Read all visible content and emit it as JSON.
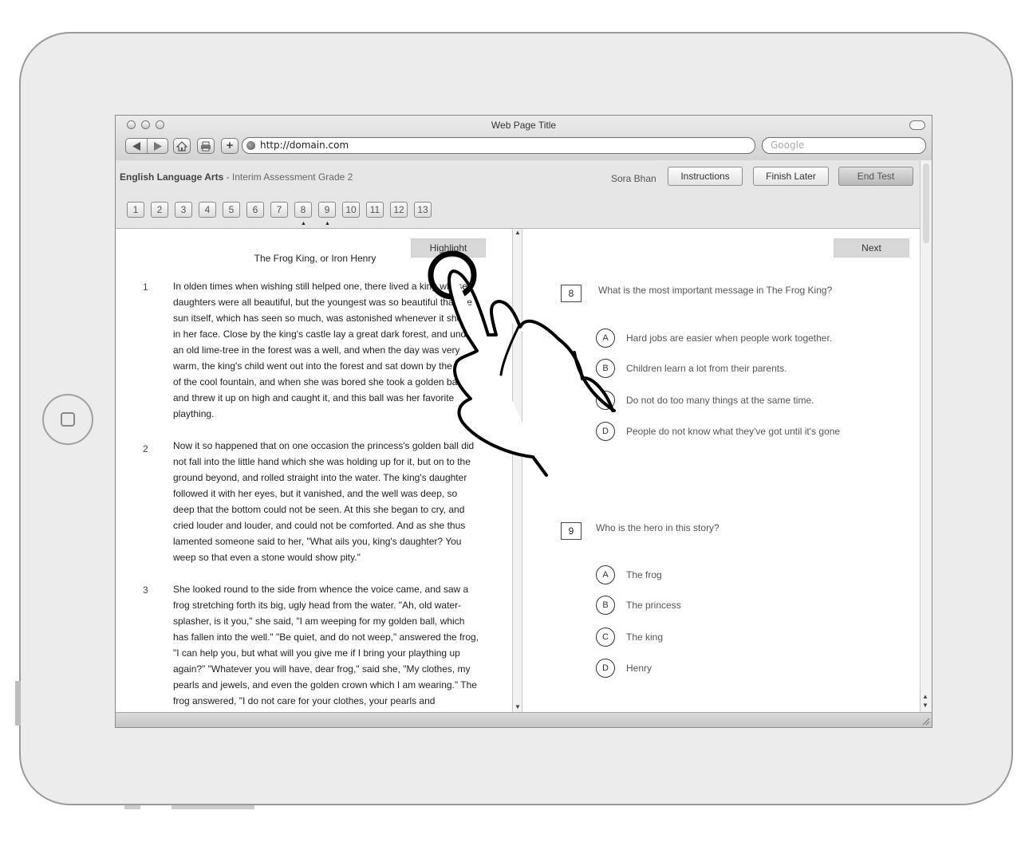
{
  "window": {
    "title": "Web Page Title"
  },
  "browser": {
    "url": "http://domain.com",
    "search_placeholder": "Google",
    "back_icon": "left-triangle",
    "forward_icon": "right-triangle",
    "home_icon": "home",
    "print_icon": "print",
    "add_icon": "+"
  },
  "app": {
    "subject": "English Language Arts",
    "assessment": " - Interim Assessment Grade 2",
    "user": "Sora Bhan",
    "instructions_label": "Instructions",
    "finish_later_label": "Finish Later",
    "end_test_label": "End Test"
  },
  "question_numbers": [
    "1",
    "2",
    "3",
    "4",
    "5",
    "6",
    "7",
    "8",
    "9",
    "10",
    "11",
    "12",
    "13"
  ],
  "flag_marker": "▲",
  "flagged_questions": [
    "8",
    "9"
  ],
  "passage": {
    "highlight_label": "Highlight",
    "title": "The Frog King, or Iron Henry",
    "paragraphs": [
      {
        "num": "1",
        "text": "In olden times when wishing still helped one, there lived a king whose daughters were all beautiful, but the youngest was so beautiful that the sun itself, which has seen so much, was astonished whenever it shone in her face.  Close by the king's castle lay a great dark forest, and under an old lime-tree in the forest was a well, and when the day was very warm, the king's child went out into the forest and sat down by the side of the cool fountain, and when she was bored she took a golden ball, and threw it up on high and caught it, and this ball was her favorite plaything."
      },
      {
        "num": "2",
        "text": "Now it so happened that on one occasion the princess's golden ball did not fall into the little hand which she was holding up for it, but on to the ground beyond, and rolled straight into the water.  The king's daughter followed it with her eyes, but it vanished, and the well was deep, so deep that the bottom could not be seen.  At this she began to cry, and cried louder and louder, and could not be comforted.  And as she thus lamented someone said to her, \"What ails you, king's daughter?  You weep so that even a stone would show pity.\""
      },
      {
        "num": "3",
        "text": "She looked round to the side from whence the voice came, and saw a frog stretching forth its big, ugly head from the water.  \"Ah, old water-splasher, is it you,\" she said, \"I am weeping for my golden ball, which has fallen into the well.\"  \"Be quiet, and do not weep,\" answered the frog, \"I can help you, but what will you give me if I bring your plaything up again?\"  \"Whatever you will have, dear frog,\" said she, \"My clothes, my pearls and jewels, and even the golden crown which I am wearing.\"  The frog answered, \"I do not care for your clothes, your pearls and"
      }
    ]
  },
  "questions_panel": {
    "next_label": "Next",
    "questions": [
      {
        "num": "8",
        "text": "What is the most important message in The Frog King?",
        "options": [
          {
            "letter": "A",
            "text": "Hard jobs are easier when people work together."
          },
          {
            "letter": "B",
            "text": "Children learn a lot from their parents."
          },
          {
            "letter": "C",
            "text": "Do not do too many things at the same time."
          },
          {
            "letter": "D",
            "text": "People do not know what they've got until it's gone"
          }
        ]
      },
      {
        "num": "9",
        "text": "Who is the hero in this story?",
        "options": [
          {
            "letter": "A",
            "text": "The frog"
          },
          {
            "letter": "B",
            "text": "The princess"
          },
          {
            "letter": "C",
            "text": "The king"
          },
          {
            "letter": "D",
            "text": "Henry"
          }
        ]
      }
    ]
  },
  "colors": {
    "chrome": "#d3d3d3",
    "header_bg": "#e6e6e6",
    "highlight_btn": "#d8d8d8",
    "bezel": "#ececec"
  }
}
